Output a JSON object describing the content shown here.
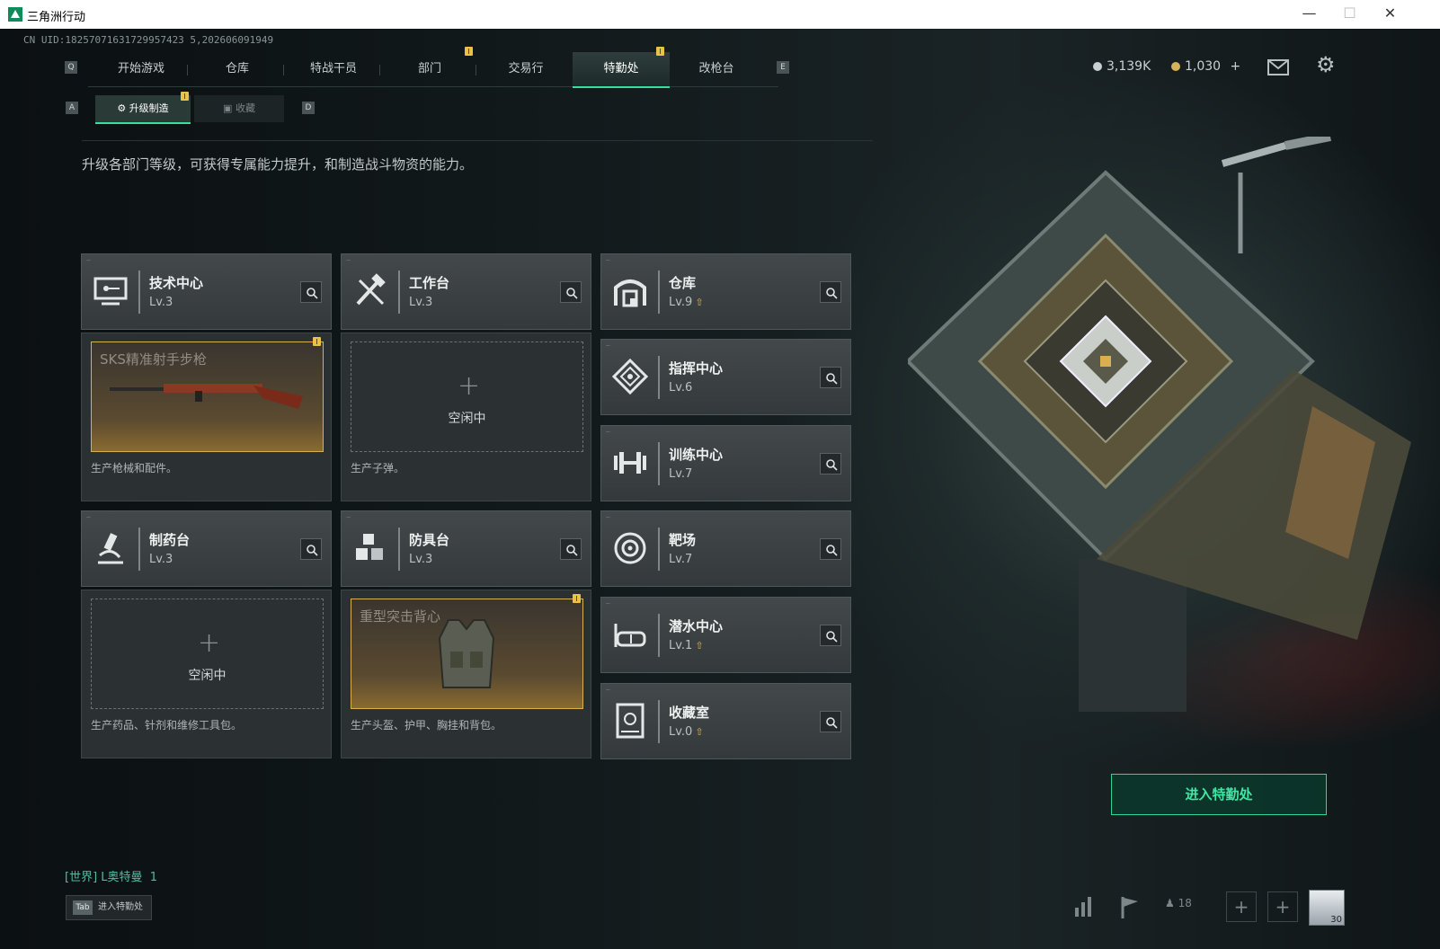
{
  "window": {
    "title": "三角洲行动"
  },
  "uid": "CN UID:18257071631729957423 5,202606091949",
  "nav": {
    "key_left": "Q",
    "key_right": "E",
    "tabs": [
      "开始游戏",
      "仓库",
      "特战干员",
      "部门",
      "交易行",
      "特勤处",
      "改枪台"
    ],
    "active": "特勤处"
  },
  "subnav": {
    "key_left": "A",
    "key_right": "D",
    "tabs": [
      "升级制造",
      "收藏"
    ],
    "active": "升级制造"
  },
  "resources": {
    "currency1": "3,139K",
    "currency2": "1,030",
    "add_label": "+"
  },
  "description": "升级各部门等级，可获得专属能力提升，和制造战斗物资的能力。",
  "departments": [
    {
      "name": "技术中心",
      "level": "Lv.3",
      "icon": "monitor-icon",
      "upgradable": false
    },
    {
      "name": "工作台",
      "level": "Lv.3",
      "icon": "tools-icon",
      "upgradable": false
    },
    {
      "name": "仓库",
      "level": "Lv.9",
      "icon": "warehouse-icon",
      "upgradable": true
    },
    {
      "name": "指挥中心",
      "level": "Lv.6",
      "icon": "command-icon",
      "upgradable": false
    },
    {
      "name": "训练中心",
      "level": "Lv.7",
      "icon": "dumbbell-icon",
      "upgradable": false
    },
    {
      "name": "制药台",
      "level": "Lv.3",
      "icon": "microscope-icon",
      "upgradable": false
    },
    {
      "name": "防具台",
      "level": "Lv.3",
      "icon": "armor-boxes-icon",
      "upgradable": false
    },
    {
      "name": "靶场",
      "level": "Lv.7",
      "icon": "target-icon",
      "upgradable": false
    },
    {
      "name": "潜水中心",
      "level": "Lv.1",
      "icon": "diving-mask-icon",
      "upgradable": true
    },
    {
      "name": "收藏室",
      "level": "Lv.0",
      "icon": "collection-icon",
      "upgradable": true
    }
  ],
  "production": [
    {
      "item": "SKS精准射手步枪",
      "desc": "生产枪械和配件。",
      "state": "busy"
    },
    {
      "idle_label": "空闲中",
      "desc": "生产子弹。",
      "state": "idle"
    },
    {
      "idle_label": "空闲中",
      "desc": "生产药品、针剂和维修工具包。",
      "state": "idle"
    },
    {
      "item": "重型突击背心",
      "desc": "生产头盔、护甲、胸挂和背包。",
      "state": "busy"
    }
  ],
  "enter_button": "进入特勤处",
  "chat": {
    "channel": "[世界]",
    "user": "L奥特曼",
    "msg": "1"
  },
  "bottom_hint": {
    "key": "Tab",
    "label": "进入特勤处"
  },
  "friends_count": "18",
  "avatar_level": "30",
  "colors": {
    "accent": "#38e0a0",
    "notif": "#e8c34a",
    "busy_border": "#d8b050"
  }
}
